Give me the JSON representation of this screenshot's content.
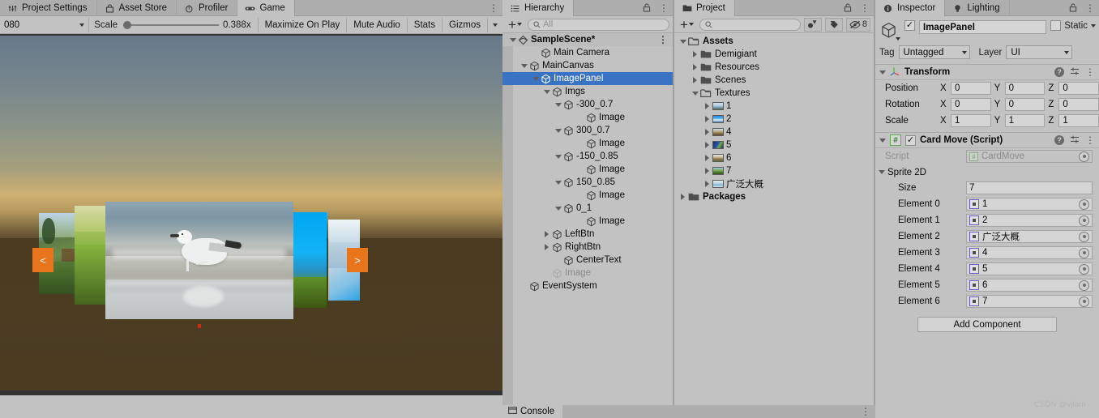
{
  "app": {
    "watermark": "CSDN @vjlam"
  },
  "gameview": {
    "tabs": [
      {
        "label": "Project Settings",
        "icon": "sliders-icon",
        "active": false
      },
      {
        "label": "Asset Store",
        "icon": "store-icon",
        "active": false
      },
      {
        "label": "Profiler",
        "icon": "stopwatch-icon",
        "active": false
      },
      {
        "label": "Game",
        "icon": "gamepad-icon",
        "active": true
      }
    ],
    "toolbar": {
      "resolution": "080",
      "scale_label": "Scale",
      "scale_value": "0.388x",
      "maximize_on_play": "Maximize On Play",
      "mute_audio": "Mute Audio",
      "stats": "Stats",
      "gizmos": "Gizmos"
    },
    "carousel": {
      "left_button": "<",
      "right_button": ">",
      "cards": [
        {
          "name": "-300_0.7"
        },
        {
          "name": "-150_0.85"
        },
        {
          "name": "0_1"
        },
        {
          "name": "150_0.85"
        },
        {
          "name": "300_0.7"
        }
      ]
    }
  },
  "hierarchy": {
    "tab_label": "Hierarchy",
    "search_placeholder": "All",
    "rows": [
      {
        "label": "SampleScene*",
        "depth": 0,
        "twisty": "down",
        "icon": "scene-icon",
        "bold": true,
        "selected": false,
        "dim": false
      },
      {
        "label": "Main Camera",
        "depth": 2,
        "twisty": "none",
        "icon": "gameobject-icon",
        "bold": false,
        "selected": false,
        "dim": false
      },
      {
        "label": "MainCanvas",
        "depth": 1,
        "twisty": "down",
        "icon": "gameobject-icon",
        "bold": false,
        "selected": false,
        "dim": false
      },
      {
        "label": "ImagePanel",
        "depth": 2,
        "twisty": "down",
        "icon": "gameobject-icon",
        "bold": false,
        "selected": true,
        "dim": false
      },
      {
        "label": "Imgs",
        "depth": 3,
        "twisty": "down",
        "icon": "gameobject-icon",
        "bold": false,
        "selected": false,
        "dim": false
      },
      {
        "label": "-300_0.7",
        "depth": 4,
        "twisty": "down",
        "icon": "gameobject-icon",
        "bold": false,
        "selected": false,
        "dim": false
      },
      {
        "label": "Image",
        "depth": 6,
        "twisty": "none",
        "icon": "gameobject-icon",
        "bold": false,
        "selected": false,
        "dim": false
      },
      {
        "label": "300_0.7",
        "depth": 4,
        "twisty": "down",
        "icon": "gameobject-icon",
        "bold": false,
        "selected": false,
        "dim": false
      },
      {
        "label": "Image",
        "depth": 6,
        "twisty": "none",
        "icon": "gameobject-icon",
        "bold": false,
        "selected": false,
        "dim": false
      },
      {
        "label": "-150_0.85",
        "depth": 4,
        "twisty": "down",
        "icon": "gameobject-icon",
        "bold": false,
        "selected": false,
        "dim": false
      },
      {
        "label": "Image",
        "depth": 6,
        "twisty": "none",
        "icon": "gameobject-icon",
        "bold": false,
        "selected": false,
        "dim": false
      },
      {
        "label": "150_0.85",
        "depth": 4,
        "twisty": "down",
        "icon": "gameobject-icon",
        "bold": false,
        "selected": false,
        "dim": false
      },
      {
        "label": "Image",
        "depth": 6,
        "twisty": "none",
        "icon": "gameobject-icon",
        "bold": false,
        "selected": false,
        "dim": false
      },
      {
        "label": "0_1",
        "depth": 4,
        "twisty": "down",
        "icon": "gameobject-icon",
        "bold": false,
        "selected": false,
        "dim": false
      },
      {
        "label": "Image",
        "depth": 6,
        "twisty": "none",
        "icon": "gameobject-icon",
        "bold": false,
        "selected": false,
        "dim": false
      },
      {
        "label": "LeftBtn",
        "depth": 3,
        "twisty": "right",
        "icon": "gameobject-icon",
        "bold": false,
        "selected": false,
        "dim": false
      },
      {
        "label": "RightBtn",
        "depth": 3,
        "twisty": "right",
        "icon": "gameobject-icon",
        "bold": false,
        "selected": false,
        "dim": false
      },
      {
        "label": "CenterText",
        "depth": 4,
        "twisty": "none",
        "icon": "gameobject-icon",
        "bold": false,
        "selected": false,
        "dim": false
      },
      {
        "label": "Image",
        "depth": 3,
        "twisty": "none",
        "icon": "gameobject-icon",
        "bold": false,
        "selected": false,
        "dim": true
      },
      {
        "label": "EventSystem",
        "depth": 1,
        "twisty": "none",
        "icon": "gameobject-icon",
        "bold": false,
        "selected": false,
        "dim": false
      }
    ]
  },
  "project": {
    "tab_label": "Project",
    "search_placeholder": "",
    "hidden_count": "8",
    "rows": [
      {
        "label": "Assets",
        "depth": 0,
        "twisty": "down",
        "icon": "folder-open-icon",
        "bold": true,
        "thumb": null
      },
      {
        "label": "Demigiant",
        "depth": 1,
        "twisty": "right",
        "icon": "folder-icon",
        "bold": false,
        "thumb": null
      },
      {
        "label": "Resources",
        "depth": 1,
        "twisty": "right",
        "icon": "folder-icon",
        "bold": false,
        "thumb": null
      },
      {
        "label": "Scenes",
        "depth": 1,
        "twisty": "right",
        "icon": "folder-icon",
        "bold": false,
        "thumb": null
      },
      {
        "label": "Textures",
        "depth": 1,
        "twisty": "down",
        "icon": "folder-open-icon",
        "bold": false,
        "thumb": null
      },
      {
        "label": "1",
        "depth": 2,
        "twisty": "right",
        "icon": "texture-icon",
        "bold": false,
        "thumb": "sky"
      },
      {
        "label": "2",
        "depth": 2,
        "twisty": "right",
        "icon": "texture-icon",
        "bold": false,
        "thumb": "blue"
      },
      {
        "label": "4",
        "depth": 2,
        "twisty": "right",
        "icon": "texture-icon",
        "bold": false,
        "thumb": "sand"
      },
      {
        "label": "5",
        "depth": 2,
        "twisty": "right",
        "icon": "texture-icon",
        "bold": false,
        "thumb": "navy"
      },
      {
        "label": "6",
        "depth": 2,
        "twisty": "right",
        "icon": "texture-icon",
        "bold": false,
        "thumb": "temple"
      },
      {
        "label": "7",
        "depth": 2,
        "twisty": "right",
        "icon": "texture-icon",
        "bold": false,
        "thumb": "green"
      },
      {
        "label": "广泛大概",
        "depth": 2,
        "twisty": "right",
        "icon": "texture-icon",
        "bold": false,
        "thumb": "shore"
      },
      {
        "label": "Packages",
        "depth": 0,
        "twisty": "right",
        "icon": "folder-icon",
        "bold": true,
        "thumb": null
      }
    ]
  },
  "inspector": {
    "tabs": [
      {
        "label": "Inspector",
        "icon": "info-icon",
        "active": true
      },
      {
        "label": "Lighting",
        "icon": "bulb-icon",
        "active": false
      }
    ],
    "object_name": "ImagePanel",
    "enabled": true,
    "static_label": "Static",
    "tag_label": "Tag",
    "tag_value": "Untagged",
    "layer_label": "Layer",
    "layer_value": "UI",
    "transform": {
      "title": "Transform",
      "rows": [
        {
          "label": "Position",
          "x": "0",
          "y": "0",
          "z": "0"
        },
        {
          "label": "Rotation",
          "x": "0",
          "y": "0",
          "z": "0"
        },
        {
          "label": "Scale",
          "x": "1",
          "y": "1",
          "z": "1"
        }
      ]
    },
    "script_component": {
      "title": "Card Move (Script)",
      "enabled": true,
      "script_label": "Script",
      "script_value": "CardMove",
      "array_label": "Sprite 2D",
      "size_label": "Size",
      "size_value": "7",
      "elements": [
        {
          "label": "Element 0",
          "value": "1"
        },
        {
          "label": "Element 1",
          "value": "2"
        },
        {
          "label": "Element 2",
          "value": "广泛大概"
        },
        {
          "label": "Element 3",
          "value": "4"
        },
        {
          "label": "Element 4",
          "value": "5"
        },
        {
          "label": "Element 5",
          "value": "6"
        },
        {
          "label": "Element 6",
          "value": "7"
        }
      ]
    },
    "add_component": "Add Component"
  },
  "console": {
    "tab_label": "Console"
  }
}
